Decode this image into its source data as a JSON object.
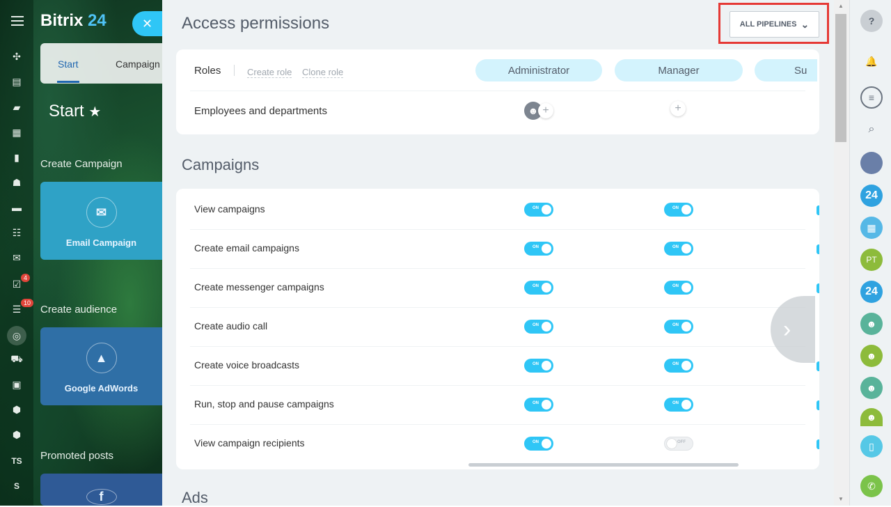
{
  "app": {
    "logo_text": "Bitrix",
    "logo_num": "24"
  },
  "left_tabs": {
    "start": "Start",
    "campaigns": "Campaign"
  },
  "left": {
    "start_title": "Start",
    "sections": [
      "Create Campaign",
      "Create audience",
      "Promoted posts"
    ],
    "cards": [
      {
        "label": "Email Campaign",
        "color": "#2fa2c6"
      },
      {
        "label": "Google AdWords",
        "color": "#2f6fa6"
      }
    ],
    "badges": [
      "4",
      "10"
    ],
    "short_labels": [
      "TS",
      "S"
    ]
  },
  "page": {
    "title": "Access permissions",
    "pipelines_button": "ALL PIPELINES"
  },
  "roles": {
    "label": "Roles",
    "create_role": "Create role",
    "clone_role": "Clone role",
    "names": [
      "Administrator",
      "Manager",
      "Su"
    ],
    "employees_label": "Employees and departments"
  },
  "campaigns": {
    "title": "Campaigns",
    "rows": [
      {
        "label": "View campaigns",
        "admin": "ON",
        "manager": "ON"
      },
      {
        "label": "Create email campaigns",
        "admin": "ON",
        "manager": "ON"
      },
      {
        "label": "Create messenger campaigns",
        "admin": "ON",
        "manager": "ON"
      },
      {
        "label": "Create audio call",
        "admin": "ON",
        "manager": "ON"
      },
      {
        "label": "Create voice broadcasts",
        "admin": "ON",
        "manager": "ON"
      },
      {
        "label": "Run, stop and pause campaigns",
        "admin": "ON",
        "manager": "ON"
      },
      {
        "label": "View campaign recipients",
        "admin": "ON",
        "manager": "OFF"
      }
    ]
  },
  "ads": {
    "title": "Ads"
  },
  "right": {
    "avatar_text": "PT",
    "logo_num": "24"
  },
  "colors": {
    "accent": "#2fc6f6",
    "role_pill": "#d3f3fd",
    "red": "#e53935",
    "green": "#8dbb3b"
  }
}
